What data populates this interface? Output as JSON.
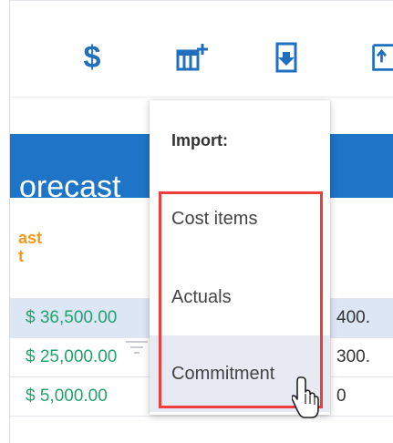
{
  "toolbar": {
    "icons": [
      "dollar-icon",
      "add-column-icon",
      "import-icon",
      "partial-icon"
    ],
    "dollar_symbol": "$",
    "accent_color": "#1f6fbf"
  },
  "table": {
    "band_title": "orecast",
    "subheader_line1": "ast",
    "subheader_line2": "t",
    "rows": [
      {
        "amount": "$ 36,500.00",
        "right": "400.",
        "highlighted": true
      },
      {
        "amount": "$ 25,000.00",
        "right": "300.",
        "highlighted": false
      },
      {
        "amount": "$ 5,000.00",
        "right": "0",
        "highlighted": false
      }
    ],
    "colors": {
      "band": "#1e74c6",
      "label": "#f29b1d",
      "amount": "#23a36c",
      "row_highlight": "#dce6f5"
    }
  },
  "menu": {
    "header": "Import:",
    "items": [
      {
        "label": "Cost items"
      },
      {
        "label": "Actuals"
      },
      {
        "label": "Commitment",
        "hovered": true
      }
    ],
    "highlight_color": "#ef3c3c"
  }
}
